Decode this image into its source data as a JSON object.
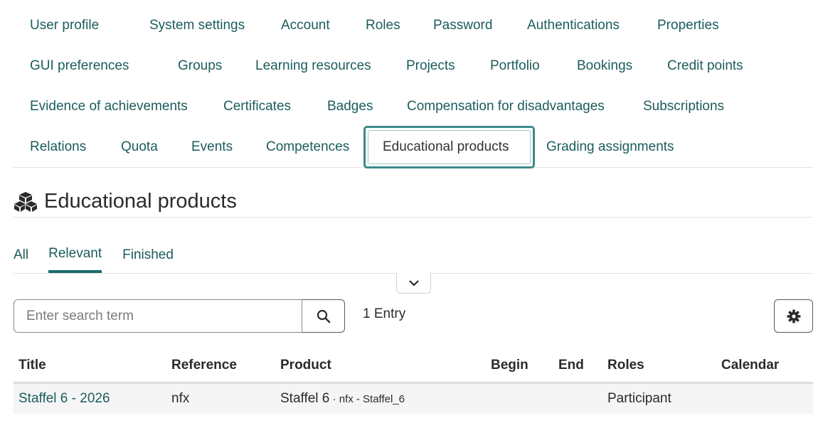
{
  "tabs": {
    "row1": [
      "User profile",
      "System settings",
      "Account",
      "Roles",
      "Password",
      "Authentications",
      "Properties"
    ],
    "row2": [
      "GUI preferences",
      "Groups",
      "Learning resources",
      "Projects",
      "Portfolio",
      "Bookings",
      "Credit points"
    ],
    "row3": [
      "Evidence of achievements",
      "Certificates",
      "Badges",
      "Compensation for disadvantages",
      "Subscriptions"
    ],
    "row4": [
      "Relations",
      "Quota",
      "Events",
      "Competences",
      "Educational products",
      "Grading assignments"
    ],
    "active": "Educational products"
  },
  "page": {
    "title": "Educational products",
    "icon": "cubes-icon"
  },
  "filters": {
    "items": [
      "All",
      "Relevant",
      "Finished"
    ],
    "active": "Relevant"
  },
  "search": {
    "placeholder": "Enter search term",
    "value": ""
  },
  "entry_count": "1 Entry",
  "table": {
    "columns": [
      "Title",
      "Reference",
      "Product",
      "Begin",
      "End",
      "Roles",
      "Calendar"
    ],
    "rows": [
      {
        "title": "Staffel 6 - 2026",
        "reference": "nfx",
        "product_main": "Staffel 6",
        "product_sub": " · nfx - Staffel_6",
        "begin": "",
        "end": "",
        "roles": "Participant",
        "calendar": ""
      }
    ]
  },
  "colors": {
    "accent": "#1c5c5c",
    "active_border": "#3a8a8a"
  }
}
